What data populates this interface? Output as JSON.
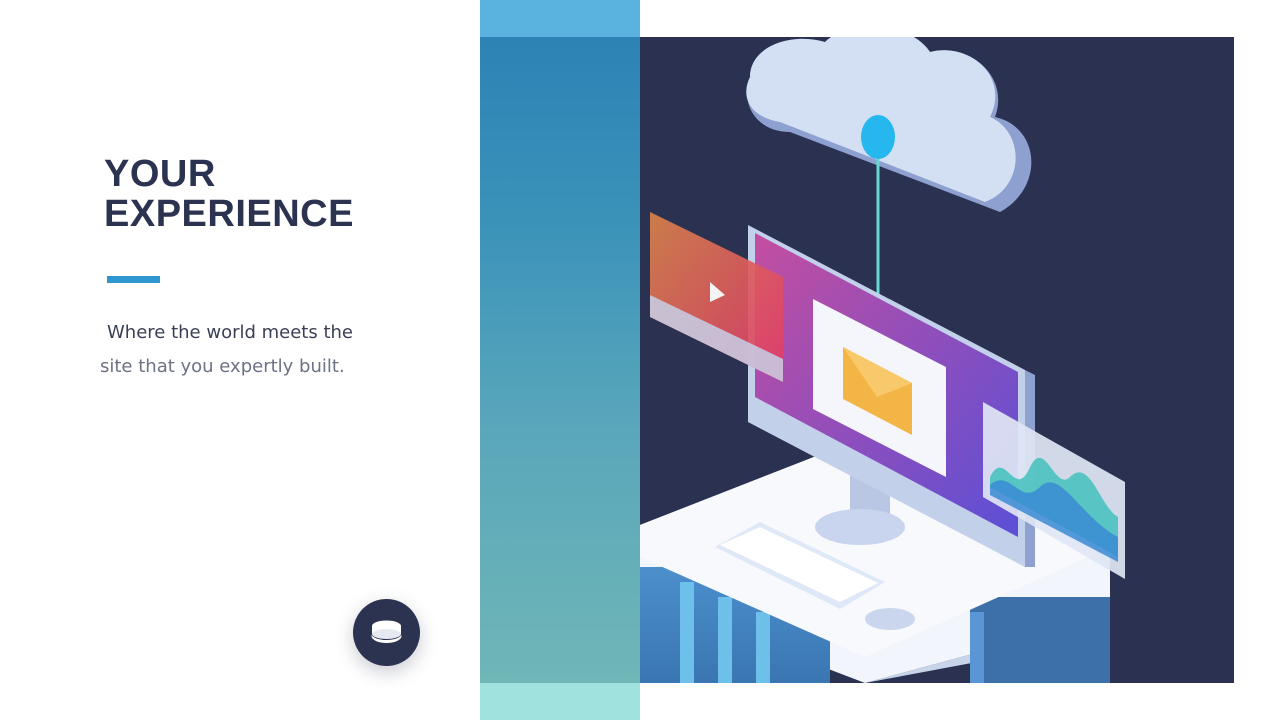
{
  "hero": {
    "title_line1": "YOUR",
    "title_line2": "EXPERIENCE",
    "subtitle_line1": "Where the world meets the",
    "subtitle_line2": "site that you expertly built."
  },
  "colors": {
    "title": "#2c3350",
    "accent": "#2f96cf",
    "illustration_bg": "#2b3150",
    "teal_strip": "#3a92b9"
  },
  "icons": {
    "fab": "layers-icon",
    "illustration": "cloud-computer-illustration"
  }
}
